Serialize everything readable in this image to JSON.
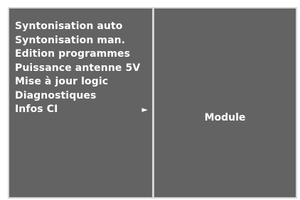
{
  "menu": {
    "items": [
      {
        "label": "Syntonisation auto"
      },
      {
        "label": "Syntonisation man."
      },
      {
        "label": "Edition programmes"
      },
      {
        "label": "Puissance antenne 5V"
      },
      {
        "label": "Mise à jour logic"
      },
      {
        "label": "Diagnostiques"
      },
      {
        "label": "Infos CI",
        "arrow": "►"
      }
    ]
  },
  "submenu": {
    "items": [
      {
        "label": "Module"
      }
    ]
  },
  "icons": {
    "submenu_arrow": "play-right-icon"
  },
  "colors": {
    "panel_bg": "#636363",
    "frame": "#d4d4d4",
    "text": "#ffffff"
  }
}
